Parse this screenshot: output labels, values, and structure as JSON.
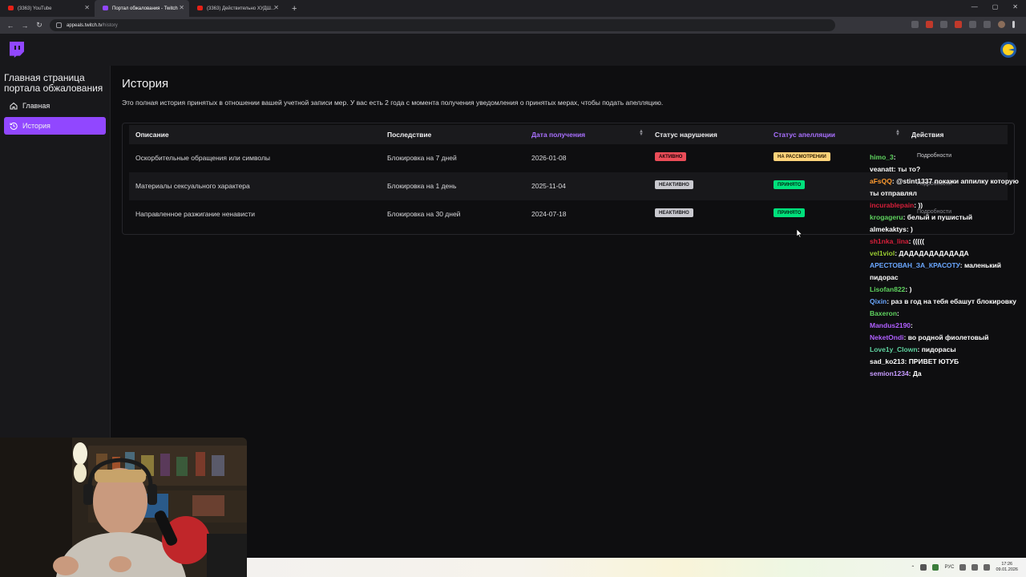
{
  "browser": {
    "tabs": [
      {
        "label": "(3363) YouTube",
        "icon": "youtube-icon"
      },
      {
        "label": "Портал обжалования - Twitch",
        "icon": "twitch-icon"
      },
      {
        "label": "(3363) Действительно ХУДШ...",
        "icon": "youtube-icon"
      }
    ],
    "url_host": "appeals.twitch.tv",
    "url_path": "/history"
  },
  "sidebar": {
    "title": "Главная страница портала обжалования",
    "items": [
      {
        "label": "Главная",
        "icon": "home-icon"
      },
      {
        "label": "История",
        "icon": "history-icon"
      }
    ]
  },
  "main": {
    "title": "История",
    "description": "Это полная история принятых в отношении вашей учетной записи мер. У вас есть 2 года с момента получения уведомления о принятых мерах, чтобы подать апелляцию.",
    "columns": [
      "Описание",
      "Последствие",
      "Дата получения",
      "Статус нарушения",
      "Статус апелляции",
      "Действия"
    ],
    "rows": [
      {
        "description": "Оскорбительные обращения или символы",
        "consequence": "Блокировка на 7 дней",
        "date": "2026-01-08",
        "violation_status": "АКТИВНО",
        "appeal_status": "НА РАССМОТРЕНИИ",
        "action": "Подробности"
      },
      {
        "description": "Материалы сексуального характера",
        "consequence": "Блокировка на 1 день",
        "date": "2025-11-04",
        "violation_status": "НЕАКТИВНО",
        "appeal_status": "ПРИНЯТО",
        "action": "Подробности"
      },
      {
        "description": "Направленное разжигание ненависти",
        "consequence": "Блокировка на 30 дней",
        "date": "2024-07-18",
        "violation_status": "НЕАКТИВНО",
        "appeal_status": "ПРИНЯТО",
        "action": "Подробности"
      }
    ]
  },
  "chat": [
    {
      "user": "himo_3",
      "text": "",
      "color": "#5fd35f"
    },
    {
      "user": "veanatt",
      "text": "ты то?",
      "color": "#ffffff"
    },
    {
      "user": "aFsQQ",
      "text": "@stint1337 покажи аппилку которую ты отправлял",
      "color": "#ff9b2f"
    },
    {
      "user": "incurablepain",
      "text": "))",
      "color": "#d81f3a"
    },
    {
      "user": "krogageru",
      "text": "белый и пушистый",
      "color": "#5fd35f"
    },
    {
      "user": "almekaktys",
      "text": ")",
      "color": "#ffffff"
    },
    {
      "user": "sh1nka_lina",
      "text": "(((((",
      "color": "#d81f3a"
    },
    {
      "user": "vel1viol",
      "text": "ДАДАДАДАДАДАДА",
      "color": "#9acd32"
    },
    {
      "user": "АРЕСТОВАН_ЗА_КРАСОТУ",
      "text": "маленький пидорас",
      "color": "#6aa7ff"
    },
    {
      "user": "Lisofan822",
      "text": ")",
      "color": "#5fd35f"
    },
    {
      "user": "Qixin",
      "text": "раз в год на тебя ебашут блокировку",
      "color": "#6aa7ff"
    },
    {
      "user": "Baxeron",
      "text": "",
      "color": "#5fd35f"
    },
    {
      "user": "Mandus2190",
      "text": "",
      "color": "#b05fff"
    },
    {
      "user": "NeketOndi",
      "text": "во родной фиолетовый",
      "color": "#b05fff"
    },
    {
      "user": "Love1y_Clown",
      "text": "пидорасы",
      "color": "#5fd3a0"
    },
    {
      "user": "sad_ko213",
      "text": "ПРИВЕТ ЮТУБ",
      "color": "#ffffff"
    },
    {
      "user": "semion1234",
      "text": "Да",
      "color": "#c79bff"
    }
  ],
  "taskbar": {
    "lang": "РУС",
    "time": "17:26",
    "date": "09.01.2026"
  }
}
